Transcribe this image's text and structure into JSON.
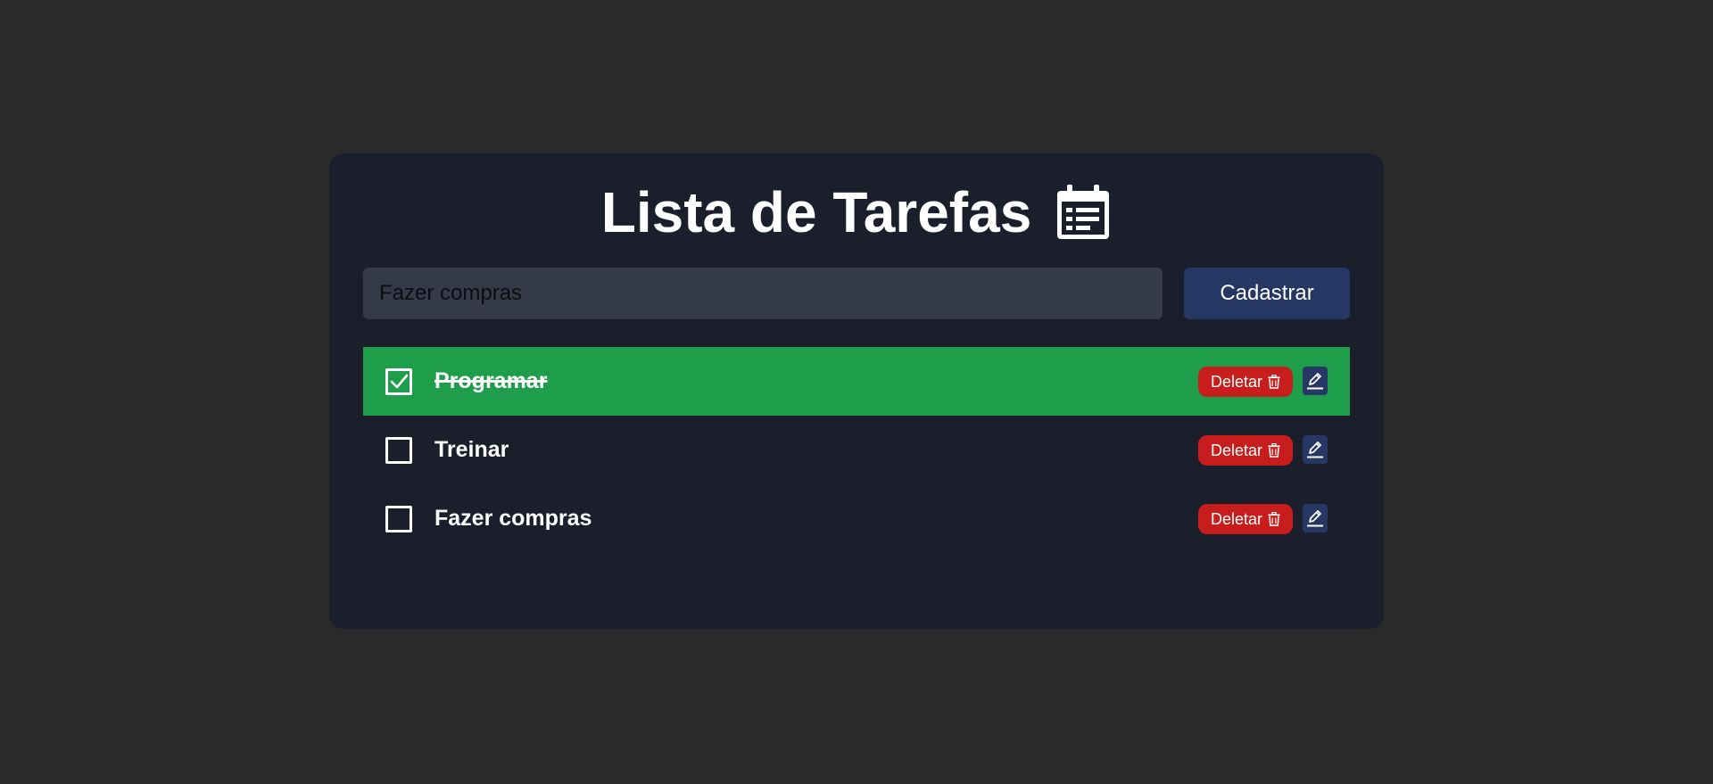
{
  "header": {
    "title": "Lista de Tarefas",
    "icon": "calendar-list-icon"
  },
  "form": {
    "input_value": "",
    "input_placeholder": "Fazer compras",
    "submit_label": "Cadastrar"
  },
  "tasks": [
    {
      "label": "Programar",
      "done": true,
      "delete_label": "Deletar",
      "delete_icon": "trash-icon",
      "edit_icon": "pencil-icon"
    },
    {
      "label": "Treinar",
      "done": false,
      "delete_label": "Deletar",
      "delete_icon": "trash-icon",
      "edit_icon": "pencil-icon"
    },
    {
      "label": "Fazer compras",
      "done": false,
      "delete_label": "Deletar",
      "delete_icon": "trash-icon",
      "edit_icon": "pencil-icon"
    }
  ],
  "colors": {
    "page_background": "#2a2a2a",
    "card_background": "#1a1f2b",
    "input_background": "#343a48",
    "primary_button": "#253762",
    "done_row": "#1e9e4a",
    "delete_button": "#c81d1d",
    "text": "#ffffff"
  }
}
